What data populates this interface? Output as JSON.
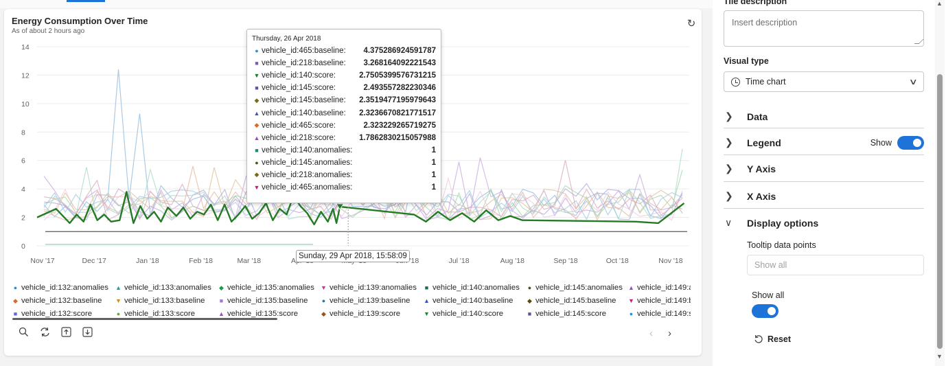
{
  "card": {
    "title": "Energy Consumption Over Time",
    "subtitle": "As of about 2 hours ago",
    "refresh_icon": "refresh-icon"
  },
  "chart_data": {
    "type": "line",
    "ylim": [
      0,
      14
    ],
    "y_ticks": [
      "0",
      "2",
      "4",
      "6",
      "8",
      "10",
      "12",
      "14"
    ],
    "x_ticks": [
      "Nov '17",
      "Dec '17",
      "Jan '18",
      "Feb '18",
      "Mar '18",
      "Apr '18",
      "May '18",
      "Jun '18",
      "Jul '18",
      "Aug '18",
      "Sep '18",
      "Oct '18",
      "Nov '18"
    ],
    "x_range": [
      "2017-11-01",
      "2018-11-15"
    ],
    "grid": true,
    "highlight_series": "vehicle_id:140:score",
    "highlight_color": "#257a25",
    "highlight_points": [
      [
        "2017-11-01",
        2.0
      ],
      [
        "2017-11-12",
        2.6
      ],
      [
        "2017-11-20",
        1.6
      ],
      [
        "2017-11-24",
        2.2
      ],
      [
        "2017-11-28",
        1.7
      ],
      [
        "2017-12-02",
        2.9
      ],
      [
        "2017-12-06",
        1.8
      ],
      [
        "2017-12-10",
        2.2
      ],
      [
        "2017-12-14",
        1.7
      ],
      [
        "2017-12-19",
        1.8
      ],
      [
        "2017-12-23",
        3.8
      ],
      [
        "2017-12-27",
        1.6
      ],
      [
        "2017-12-31",
        2.8
      ],
      [
        "2018-01-04",
        1.9
      ],
      [
        "2018-01-08",
        2.4
      ],
      [
        "2018-01-12",
        1.7
      ],
      [
        "2018-01-16",
        2.7
      ],
      [
        "2018-01-21",
        2.1
      ],
      [
        "2018-01-25",
        2.7
      ],
      [
        "2018-01-29",
        1.9
      ],
      [
        "2018-02-02",
        2.4
      ],
      [
        "2018-02-06",
        2.2
      ],
      [
        "2018-02-10",
        2.9
      ],
      [
        "2018-02-14",
        1.8
      ],
      [
        "2018-02-18",
        2.9
      ],
      [
        "2018-02-22",
        1.7
      ],
      [
        "2018-02-26",
        2.2
      ],
      [
        "2018-03-02",
        2.8
      ],
      [
        "2018-03-06",
        1.9
      ],
      [
        "2018-03-10",
        2.3
      ],
      [
        "2018-03-14",
        3.0
      ],
      [
        "2018-03-18",
        1.8
      ],
      [
        "2018-03-22",
        2.6
      ],
      [
        "2018-03-26",
        2.2
      ],
      [
        "2018-03-30",
        3.5
      ],
      [
        "2018-04-03",
        2.8
      ],
      [
        "2018-04-07",
        2.3
      ],
      [
        "2018-04-11",
        1.5
      ],
      [
        "2018-04-15",
        2.4
      ],
      [
        "2018-04-19",
        1.7
      ],
      [
        "2018-04-22",
        2.6
      ],
      [
        "2018-04-24",
        1.6
      ],
      [
        "2018-04-26",
        2.75
      ],
      [
        "2018-06-08",
        2.2
      ],
      [
        "2018-06-15",
        1.7
      ],
      [
        "2018-06-22",
        2.4
      ],
      [
        "2018-06-29",
        1.8
      ],
      [
        "2018-07-06",
        2.3
      ],
      [
        "2018-07-13",
        1.7
      ],
      [
        "2018-07-20",
        2.5
      ],
      [
        "2018-07-27",
        1.8
      ],
      [
        "2018-08-03",
        2.1
      ],
      [
        "2018-08-10",
        1.8
      ],
      [
        "2018-10-15",
        1.7
      ],
      [
        "2018-10-28",
        1.6
      ],
      [
        "2018-11-12",
        3.0
      ]
    ],
    "background_colors": [
      "#8fb8de",
      "#e8b4a0",
      "#c9a6e0",
      "#a6d4a6",
      "#f0c8dc",
      "#9cc8e8",
      "#e0c09a",
      "#b0a8d8",
      "#a8d8c8",
      "#d8a8b8"
    ],
    "tooltip": {
      "date": "Thursday, 26 Apr 2018",
      "rows": [
        {
          "name": "vehicle_id:465:baseline:",
          "value": "4.375286924591787",
          "marker": "●",
          "color": "#2f8fd5"
        },
        {
          "name": "vehicle_id:218:baseline:",
          "value": "3.268164092221543",
          "marker": "■",
          "color": "#7b5ea6"
        },
        {
          "name": "vehicle_id:140:score:",
          "value": "2.7505399576731215",
          "marker": "▼",
          "color": "#257a25"
        },
        {
          "name": "vehicle_id:145:score:",
          "value": "2.493557282230346",
          "marker": "■",
          "color": "#6a4ca0"
        },
        {
          "name": "vehicle_id:145:baseline:",
          "value": "2.3519477195979643",
          "marker": "◆",
          "color": "#7a6a1a"
        },
        {
          "name": "vehicle_id:140:baseline:",
          "value": "2.3236670821771517",
          "marker": "▲",
          "color": "#3a56b8"
        },
        {
          "name": "vehicle_id:465:score:",
          "value": "2.323229265719275",
          "marker": "◆",
          "color": "#d9692a"
        },
        {
          "name": "vehicle_id:218:score:",
          "value": "1.7862830215057988",
          "marker": "▲",
          "color": "#9a4ac8"
        },
        {
          "name": "vehicle_id:140:anomalies:",
          "value": "1",
          "marker": "■",
          "color": "#1a8a7a"
        },
        {
          "name": "vehicle_id:145:anomalies:",
          "value": "1",
          "marker": "●",
          "color": "#3f5a1a"
        },
        {
          "name": "vehicle_id:218:anomalies:",
          "value": "1",
          "marker": "◆",
          "color": "#7a6a1a"
        },
        {
          "name": "vehicle_id:465:anomalies:",
          "value": "1",
          "marker": "▼",
          "color": "#c0207a"
        }
      ]
    },
    "hover_label": "Sunday, 29 Apr 2018, 15:58:09"
  },
  "legend": {
    "items": [
      {
        "label": "vehicle_id:132:anomalies",
        "marker": "●",
        "color": "#2f8fd5"
      },
      {
        "label": "vehicle_id:133:anomalies",
        "marker": "▲",
        "color": "#1aa0a8"
      },
      {
        "label": "vehicle_id:135:anomalies",
        "marker": "◆",
        "color": "#1a9a4a"
      },
      {
        "label": "vehicle_id:139:anomalies",
        "marker": "▼",
        "color": "#d0309a"
      },
      {
        "label": "vehicle_id:140:anomalies",
        "marker": "■",
        "color": "#1a6a5a"
      },
      {
        "label": "vehicle_id:145:anomalies",
        "marker": "●",
        "color": "#3f5a1a"
      },
      {
        "label": "vehicle_id:149:a",
        "marker": "▲",
        "color": "#9a4ac8"
      },
      {
        "label": "vehicle_id:132:baseline",
        "marker": "◆",
        "color": "#d9692a"
      },
      {
        "label": "vehicle_id:133:baseline",
        "marker": "▼",
        "color": "#c8901a"
      },
      {
        "label": "vehicle_id:135:baseline",
        "marker": "■",
        "color": "#a07ac8"
      },
      {
        "label": "vehicle_id:139:baseline",
        "marker": "●",
        "color": "#2a78b0"
      },
      {
        "label": "vehicle_id:140:baseline",
        "marker": "▲",
        "color": "#3a56b8"
      },
      {
        "label": "vehicle_id:145:baseline",
        "marker": "◆",
        "color": "#5a4a10"
      },
      {
        "label": "vehicle_id:149:b",
        "marker": "▼",
        "color": "#c0207a"
      },
      {
        "label": "vehicle_id:132:score",
        "marker": "■",
        "color": "#5a6ad8"
      },
      {
        "label": "vehicle_id:133:score",
        "marker": "●",
        "color": "#6aa83a"
      },
      {
        "label": "vehicle_id:135:score",
        "marker": "▲",
        "color": "#a04ad0"
      },
      {
        "label": "vehicle_id:139:score",
        "marker": "◆",
        "color": "#a0501a"
      },
      {
        "label": "vehicle_id:140:score",
        "marker": "▼",
        "color": "#1a8a2a"
      },
      {
        "label": "vehicle_id:145:score",
        "marker": "■",
        "color": "#6a4ca0"
      },
      {
        "label": "vehicle_id:149:s",
        "marker": "●",
        "color": "#2f8fd5"
      }
    ]
  },
  "toolbar": {
    "icons": [
      "search-icon",
      "reset-zoom-icon",
      "upload-icon",
      "download-icon"
    ],
    "prev": "‹",
    "next": "›"
  },
  "panel": {
    "tile_description_label": "Tile description",
    "description_placeholder": "Insert description",
    "visual_type_label": "Visual type",
    "visual_type_value": "Time chart",
    "sections": {
      "data": "Data",
      "legend": "Legend",
      "legend_show": "Show",
      "y_axis": "Y Axis",
      "x_axis": "X Axis",
      "display_options": "Display options"
    },
    "tooltip_data_points_label": "Tooltip data points",
    "tooltip_data_points_placeholder": "Show all",
    "show_all_label": "Show all",
    "reset_label": "Reset"
  }
}
